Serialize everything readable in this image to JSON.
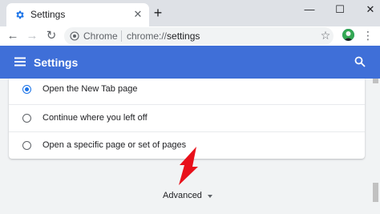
{
  "tab": {
    "title": "Settings",
    "close_glyph": "✕",
    "favicon": "gear-icon"
  },
  "new_tab_glyph": "+",
  "window": {
    "minimize": "—",
    "maximize": "☐",
    "close": "✕"
  },
  "toolbar": {
    "back_glyph": "←",
    "forward_glyph": "→",
    "reload_glyph": "↻",
    "star_glyph": "☆",
    "menu_glyph": "⋮"
  },
  "omnibox": {
    "chip": "Chrome",
    "scheme": "chrome://",
    "path": "settings"
  },
  "appbar": {
    "title": "Settings",
    "color": "#3f6fd8"
  },
  "startup_options": [
    {
      "label": "Open the New Tab page",
      "selected": true
    },
    {
      "label": "Continue where you left off",
      "selected": false
    },
    {
      "label": "Open a specific page or set of pages",
      "selected": false
    }
  ],
  "advanced": {
    "label": "Advanced"
  },
  "colors": {
    "accent": "#1a73e8",
    "arrow": "#e8101a",
    "page_bg": "#f1f3f4"
  }
}
